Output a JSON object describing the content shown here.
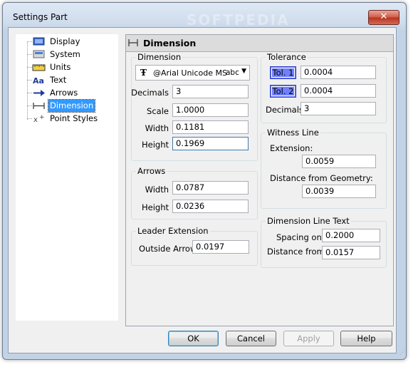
{
  "window": {
    "title": "Settings Part",
    "close_glyph": "✕"
  },
  "tree": {
    "items": [
      {
        "label": "Display",
        "icon": "display-icon"
      },
      {
        "label": "System",
        "icon": "system-icon"
      },
      {
        "label": "Units",
        "icon": "units-ruler-icon"
      },
      {
        "label": "Text",
        "icon": "text-aa-icon"
      },
      {
        "label": "Arrows",
        "icon": "arrow-icon"
      },
      {
        "label": "Dimension",
        "icon": "dimension-icon",
        "selected": true
      },
      {
        "label": "Point Styles",
        "icon": "point-style-icon"
      }
    ]
  },
  "panel": {
    "title": "Dimension",
    "dimension": {
      "group_title": "Dimension",
      "font_name": "@Arial Unicode MS",
      "font_sample": "abc",
      "decimals_label": "Decimals",
      "decimals_value": "3",
      "scale_label": "Scale",
      "scale_value": "1.0000",
      "width_label": "Width",
      "width_value": "0.1181",
      "height_label": "Height",
      "height_value": "0.1969"
    },
    "arrows": {
      "group_title": "Arrows",
      "width_label": "Width",
      "width_value": "0.0787",
      "height_label": "Height",
      "height_value": "0.0236"
    },
    "leader": {
      "group_title": "Leader Extension",
      "outside_label": "Outside Arrow",
      "outside_value": "0.0197"
    },
    "tolerance": {
      "group_title": "Tolerance",
      "tol1_label": "Tol. 1",
      "tol1_value": "0.0004",
      "tol2_label": "Tol. 2",
      "tol2_value": "0.0004",
      "decimals_label": "Decimals",
      "decimals_value": "3"
    },
    "witness": {
      "group_title": "Witness Line",
      "extension_label": "Extension:",
      "extension_value": "0.0059",
      "distance_label": "Distance from Geometry:",
      "distance_value": "0.0039"
    },
    "dimtext": {
      "group_title": "Dimension Line Text",
      "spacing_label": "Spacing on",
      "spacing_value": "0.2000",
      "distance_label": "Distance from",
      "distance_value": "0.0157"
    }
  },
  "buttons": {
    "ok": "OK",
    "cancel": "Cancel",
    "apply": "Apply",
    "help": "Help"
  },
  "watermark": "SOFTPEDIA"
}
